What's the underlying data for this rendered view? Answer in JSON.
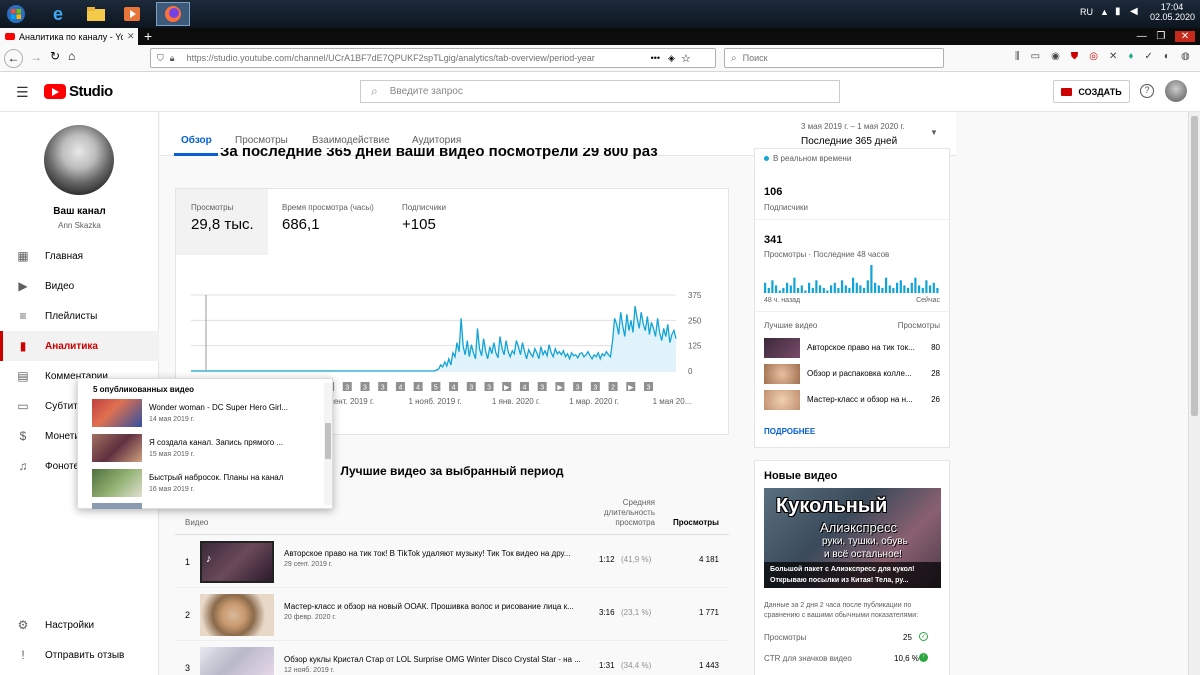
{
  "taskbar": {
    "lang": "RU",
    "time": "17:04",
    "date": "02.05.2020"
  },
  "browser": {
    "tab_title": "Аналитика по каналу - YouTu",
    "url": "https://studio.youtube.com/channel/UCrA1BF7dE7QPUKF2spTLgig/analytics/tab-overview/period-year",
    "url_host": "studio.youtube.com",
    "search_placeholder": "Поиск"
  },
  "header": {
    "logo_text": "Studio",
    "search_placeholder": "Введите запрос",
    "create_label": "СОЗДАТЬ"
  },
  "sidebar": {
    "channel_title": "Ваш канал",
    "channel_name": "Ann Skazka",
    "items": [
      {
        "label": "Главная",
        "icon": "dashboard-icon"
      },
      {
        "label": "Видео",
        "icon": "video-icon"
      },
      {
        "label": "Плейлисты",
        "icon": "playlist-icon"
      },
      {
        "label": "Аналитика",
        "icon": "analytics-icon"
      },
      {
        "label": "Комментарии",
        "icon": "comments-icon"
      },
      {
        "label": "Субтитры",
        "icon": "subtitles-icon"
      },
      {
        "label": "Монетизация",
        "icon": "dollar-icon"
      },
      {
        "label": "Фонотека",
        "icon": "audio-library-icon"
      }
    ],
    "settings_label": "Настройки",
    "feedback_label": "Отправить отзыв"
  },
  "tabs": [
    "Обзор",
    "Просмотры",
    "Взаимодействие",
    "Аудитория"
  ],
  "period": {
    "range": "3 мая 2019 г. – 1 мая 2020 г.",
    "label": "Последние 365 дней"
  },
  "headline_partial": "За последние 365 дней ваши видео посмотрели 29 800 раз",
  "metrics": [
    {
      "label": "Просмотры",
      "value": "29,8 тыс."
    },
    {
      "label": "Время просмотра (часы)",
      "value": "686,1"
    },
    {
      "label": "Подписчики",
      "value": "+105"
    }
  ],
  "chart_data": {
    "type": "area",
    "yticks": [
      "375",
      "250",
      "125",
      "0"
    ],
    "ylim": [
      0,
      375
    ],
    "xticks": [
      "сент. 2019 г.",
      "1 нояб. 2019 г.",
      "1 янв. 2020 г.",
      "1 мар. 2020 г.",
      "1 мая 20..."
    ],
    "markers": [
      "5",
      "4",
      "2",
      "3",
      "3",
      "4",
      "▶",
      "3",
      "3",
      "3",
      "3",
      "4",
      "4",
      "5",
      "4",
      "3",
      "3",
      "▶",
      "4",
      "3",
      "▶",
      "3",
      "3",
      "2",
      "▶",
      "3"
    ],
    "values": [
      0,
      0,
      0,
      0,
      0,
      0,
      0,
      0,
      0,
      0,
      0,
      0,
      0,
      0,
      0,
      0,
      0,
      0,
      0,
      0,
      0,
      0,
      0,
      0,
      0,
      0,
      0,
      0,
      0,
      0,
      0,
      0,
      0,
      0,
      0,
      0,
      0,
      0,
      0,
      0,
      0,
      0,
      0,
      0,
      0,
      0,
      0,
      0,
      0,
      0,
      0,
      0,
      0,
      0,
      0,
      0,
      0,
      0,
      0,
      0,
      0,
      0,
      0,
      0,
      0,
      0,
      0,
      0,
      0,
      0,
      0,
      0,
      0,
      0,
      0,
      0,
      0,
      0,
      0,
      0,
      0,
      0,
      0,
      0,
      0,
      0,
      0,
      0,
      0,
      0,
      0,
      0,
      0,
      0,
      0,
      0,
      0,
      0,
      0,
      0,
      0,
      0,
      0,
      0,
      0,
      0,
      0,
      0,
      0,
      0,
      0,
      0,
      0,
      0,
      0,
      0,
      0,
      0,
      0,
      0,
      5,
      10,
      30,
      20,
      45,
      25,
      60,
      30,
      90,
      70,
      140,
      95,
      260,
      120,
      80,
      150,
      70,
      130,
      90,
      60,
      210,
      110,
      75,
      160,
      95,
      60,
      120,
      85,
      140,
      90,
      65,
      170,
      110,
      80,
      150,
      95,
      70,
      100,
      85,
      150,
      120,
      80,
      140,
      95,
      60,
      105,
      85,
      70,
      110,
      90,
      60,
      120,
      80,
      100,
      75,
      130,
      90,
      70,
      110,
      85,
      95,
      80,
      100,
      70,
      85,
      60,
      90,
      75,
      80,
      65,
      85,
      90,
      70,
      80,
      95,
      75,
      60,
      80,
      70,
      90,
      60,
      85,
      75,
      95,
      80,
      70,
      150,
      260,
      230,
      180,
      290,
      220,
      170,
      280,
      200,
      250,
      190,
      320,
      260,
      210,
      290,
      230,
      200,
      270,
      180,
      240,
      210,
      170,
      260,
      190,
      150,
      210,
      170,
      230,
      140,
      180,
      200,
      160
    ]
  },
  "realtime": {
    "label": "В реальном времени",
    "subs_value": "106",
    "subs_label": "Подписчики",
    "views_value": "341",
    "views_label": "Просмотры · Последние 48 часов",
    "spark_left": "48 ч. назад",
    "spark_right": "Сейчас",
    "spark": [
      4,
      2,
      5,
      3,
      1,
      2,
      4,
      3,
      6,
      2,
      3,
      1,
      4,
      2,
      5,
      3,
      2,
      1,
      3,
      4,
      2,
      5,
      3,
      2,
      6,
      4,
      3,
      2,
      5,
      11,
      4,
      3,
      2,
      6,
      3,
      2,
      4,
      5,
      3,
      2,
      4,
      6,
      3,
      2,
      5,
      3,
      4,
      2
    ],
    "top_header": "Лучшие видео",
    "top_header_right": "Просмотры",
    "top": [
      {
        "title": "Авторское право на тик ток...",
        "views": "80"
      },
      {
        "title": "Обзор и распаковка колле...",
        "views": "28"
      },
      {
        "title": "Мастер-класс и обзор на н...",
        "views": "26"
      }
    ],
    "more_label": "ПОДРОБНЕЕ"
  },
  "new_videos": {
    "heading": "Новые видео",
    "thumb_title_1": "Кукольный",
    "thumb_title_2": "Алиэкспресс",
    "thumb_title_3": "руки, тушки, обувь",
    "thumb_title_4": "и всё остальное!",
    "caption": "Большой пакет с Алиэкспресс для кукол! Открываю посылки из Китая! Тела, ру...",
    "note": "Данные за 2 дня 2 часа после публикации по сравнению с вашими обычными показателями:",
    "stats": [
      {
        "label": "Просмотры",
        "value": "25",
        "icon": "check-icon"
      },
      {
        "label": "CTR для значков видео",
        "value": "10,6 %",
        "icon": "up-icon"
      }
    ]
  },
  "top_videos": {
    "heading": "Лучшие видео за выбранный период",
    "col_video": "Видео",
    "col_avg_1": "Средняя",
    "col_avg_2": "длительность",
    "col_avg_3": "просмотра",
    "col_views": "Просмотры",
    "rows": [
      {
        "n": "1",
        "title": "Авторское право на тик ток! В TikTok удаляют музыку! Тик Ток видео на дру...",
        "date": "29 сент. 2019 г.",
        "dur": "1:12",
        "pct": "(41,9 %)",
        "views": "4 181"
      },
      {
        "n": "2",
        "title": "Мастер-класс и обзор на новый ООАК. Прошивка волос и рисование лица к...",
        "date": "20 февр. 2020 г.",
        "dur": "3:16",
        "pct": "(23,1 %)",
        "views": "1 771"
      },
      {
        "n": "3",
        "title": "Обзор куклы Кристал Стар от LOL Surprise OMG Winter Disco Crystal Star - на ...",
        "date": "12 нояб. 2019 г.",
        "dur": "1:31",
        "pct": "(34,4 %)",
        "views": "1 443"
      }
    ]
  },
  "popup": {
    "title": "5 опубликованных видео",
    "items": [
      {
        "title": "Wonder woman - DC Super Hero Girl...",
        "date": "14 мая 2019 г."
      },
      {
        "title": "Я создала канал. Запись прямого ...",
        "date": "15 мая 2019 г."
      },
      {
        "title": "Быстрый набросок. Планы на канал",
        "date": "16 мая 2019 г."
      }
    ]
  },
  "colors": {
    "accent": "#065fd4",
    "chart_line": "#12a4d6",
    "chart_fill": "#e0f3fa",
    "yt_red": "#ff0000",
    "active_red": "#cc0000"
  }
}
